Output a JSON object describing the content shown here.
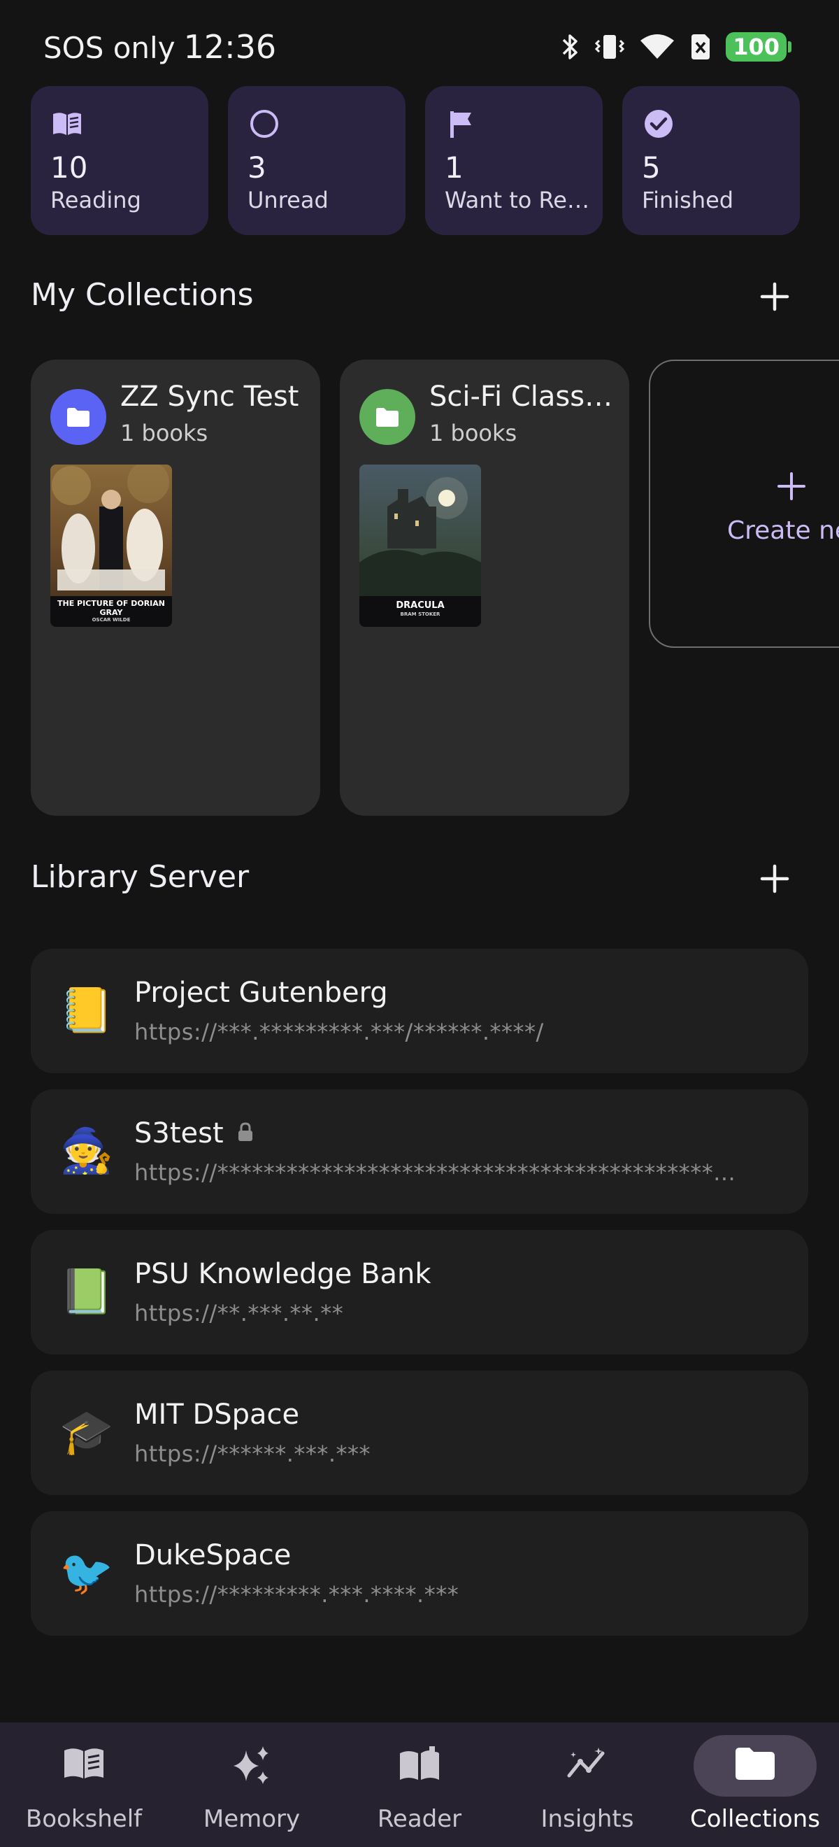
{
  "status_bar": {
    "carrier": "SOS only",
    "time": "12:36",
    "battery": "100"
  },
  "stats": [
    {
      "count": "10",
      "label": "Reading",
      "icon": "open-book-icon"
    },
    {
      "count": "3",
      "label": "Unread",
      "icon": "circle-outline-icon"
    },
    {
      "count": "1",
      "label": "Want to Re…",
      "icon": "flag-icon"
    },
    {
      "count": "5",
      "label": "Finished",
      "icon": "check-circle-icon"
    }
  ],
  "collections": {
    "title": "My Collections",
    "items": [
      {
        "name": "ZZ Sync Test",
        "count": "1 books",
        "color": "#5b63f5",
        "cover_title": "THE PICTURE OF DORIAN GRAY",
        "cover_author": "OSCAR WILDE"
      },
      {
        "name": "Sci-Fi Classi…",
        "count": "1 books",
        "color": "#5fae5a",
        "cover_title": "DRACULA",
        "cover_author": "BRAM STOKER"
      }
    ],
    "create_label": "Create ne"
  },
  "servers": {
    "title": "Library Server",
    "items": [
      {
        "emoji": "📒",
        "name": "Project Gutenberg",
        "url": "https://***.*********.***/******.****/",
        "locked": false
      },
      {
        "emoji": "🧙",
        "name": "S3test",
        "url": "https://*******************************************...",
        "locked": true
      },
      {
        "emoji": "📗",
        "name": "PSU Knowledge Bank",
        "url": "https://**.***.**.**",
        "locked": false
      },
      {
        "emoji": "🎓",
        "name": "MIT DSpace",
        "url": "https://******.***.***",
        "locked": false
      },
      {
        "emoji": "🐦",
        "name": "DukeSpace",
        "url": "https://*********.***.****.***",
        "locked": false
      }
    ]
  },
  "nav": {
    "items": [
      {
        "label": "Bookshelf",
        "icon": "bookshelf-icon"
      },
      {
        "label": "Memory",
        "icon": "sparkle-icon"
      },
      {
        "label": "Reader",
        "icon": "reader-book-icon"
      },
      {
        "label": "Insights",
        "icon": "insights-chart-icon"
      },
      {
        "label": "Collections",
        "icon": "folder-icon",
        "active": true
      }
    ]
  },
  "colors": {
    "accent": "#cbbcf5",
    "stat_card": "#2a2340",
    "background": "#141414"
  }
}
